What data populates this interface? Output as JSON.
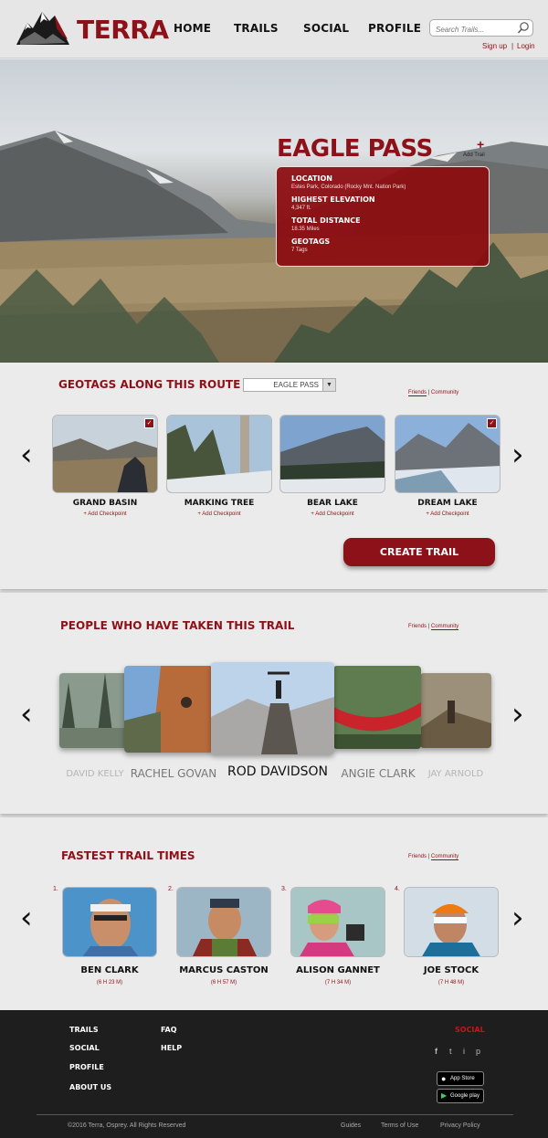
{
  "header": {
    "brand": "TERRA",
    "nav": [
      "HOME",
      "TRAILS",
      "SOCIAL",
      "PROFILE"
    ],
    "search_placeholder": "Search Trails...",
    "signup": "Sign up",
    "auth_sep": "|",
    "login": "Login"
  },
  "hero": {
    "title": "EAGLE PASS",
    "add_trail_plus": "+",
    "add_trail": "Add Trail",
    "info": [
      {
        "label": "LOCATION",
        "value": "Estes Park, Colorado (Rocky Mnt. Nation Park)"
      },
      {
        "label": "HIGHEST ELEVATION",
        "value": "4,347 ft."
      },
      {
        "label": "TOTAL DISTANCE",
        "value": "18.35 Miles"
      },
      {
        "label": "GEOTAGS",
        "value": "7 Tags"
      }
    ]
  },
  "geotags": {
    "title": "GEOTAGS ALONG THIS ROUTE",
    "select_value": "EAGLE PASS",
    "tab_friends": "Friends",
    "tab_sep": "|",
    "tab_community": "Community",
    "items": [
      {
        "name": "GRAND BASIN",
        "action": "+ Add Checkpoint",
        "checked": true
      },
      {
        "name": "MARKING TREE",
        "action": "+ Add Checkpoint",
        "checked": false
      },
      {
        "name": "BEAR LAKE",
        "action": "+ Add Checkpoint",
        "checked": false
      },
      {
        "name": "DREAM LAKE",
        "action": "+ Add Checkpoint",
        "checked": true
      }
    ],
    "create_button": "CREATE TRAIL",
    "check_glyph": "✓"
  },
  "people": {
    "title": "PEOPLE WHO HAVE TAKEN THIS TRAIL",
    "tab_friends": "Friends",
    "tab_sep": "|",
    "tab_community": "Community",
    "names": [
      "DAVID KELLY",
      "RACHEL GOVAN",
      "ROD DAVIDSON",
      "ANGIE CLARK",
      "JAY ARNOLD"
    ]
  },
  "fastest": {
    "title": "FASTEST TRAIL TIMES",
    "tab_friends": "Friends",
    "tab_sep": "|",
    "tab_community": "Community",
    "entries": [
      {
        "rank": "1.",
        "name": "BEN CLARK",
        "time": "(6 H 23 M)"
      },
      {
        "rank": "2.",
        "name": "MARCUS CASTON",
        "time": "(6 H 57 M)"
      },
      {
        "rank": "3.",
        "name": "ALISON GANNET",
        "time": "(7 H 34 M)"
      },
      {
        "rank": "4.",
        "name": "JOE STOCK",
        "time": "(7 H 48 M)"
      }
    ]
  },
  "footer": {
    "col1": [
      "TRAILS",
      "SOCIAL",
      "PROFILE",
      "ABOUT US"
    ],
    "col2": [
      "FAQ",
      "HELP"
    ],
    "social_heading": "SOCIAL",
    "social_icons": [
      "f",
      "t",
      "i",
      "p"
    ],
    "app_store": "App Store",
    "google_play": "Google play",
    "copyright": "©2016 Terra, Osprey. All Rights Reserved",
    "links": [
      "Guides",
      "Terms of Use",
      "Privacy Policy"
    ]
  },
  "colors": {
    "brand": "#8c1118",
    "footer_bg": "#1e1e1e"
  }
}
